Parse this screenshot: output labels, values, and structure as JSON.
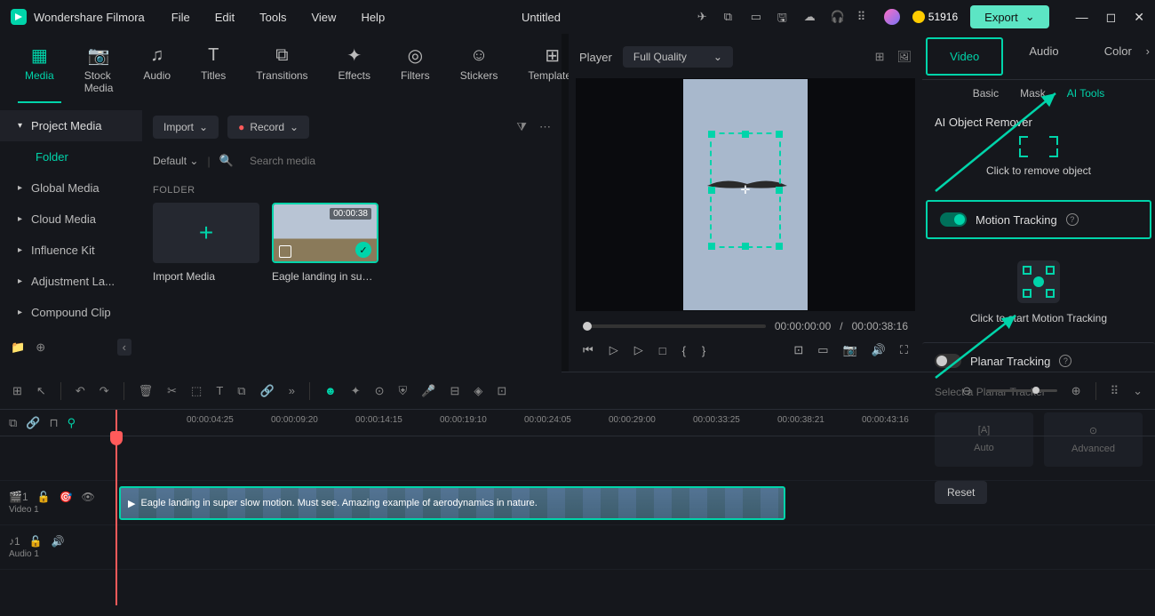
{
  "app": {
    "name": "Wondershare Filmora",
    "title": "Untitled"
  },
  "menu": [
    "File",
    "Edit",
    "Tools",
    "View",
    "Help"
  ],
  "credits": "51916",
  "export_label": "Export",
  "tool_tabs": [
    {
      "label": "Media",
      "active": true
    },
    {
      "label": "Stock Media"
    },
    {
      "label": "Audio"
    },
    {
      "label": "Titles"
    },
    {
      "label": "Transitions"
    },
    {
      "label": "Effects"
    },
    {
      "label": "Filters"
    },
    {
      "label": "Stickers"
    },
    {
      "label": "Templates"
    }
  ],
  "media_sidebar": {
    "header": "Project Media",
    "active": "Folder",
    "items": [
      "Global Media",
      "Cloud Media",
      "Influence Kit",
      "Adjustment La...",
      "Compound Clip"
    ]
  },
  "media_content": {
    "import_label": "Import",
    "record_label": "Record",
    "default_label": "Default",
    "search_placeholder": "Search media",
    "folder_label": "FOLDER",
    "import_media_label": "Import Media",
    "clip": {
      "duration": "00:00:38",
      "name": "Eagle landing in super..."
    }
  },
  "preview": {
    "player_label": "Player",
    "quality_label": "Full Quality",
    "current_time": "00:00:00:00",
    "total_time": "00:00:38:16"
  },
  "props": {
    "tabs": [
      "Video",
      "Audio",
      "Color"
    ],
    "subtabs": [
      "Basic",
      "Mask",
      "AI Tools"
    ],
    "remover_title": "AI Object Remover",
    "remover_action": "Click to remove object",
    "motion_title": "Motion Tracking",
    "motion_action": "Click to start Motion Tracking",
    "planar_title": "Planar Tracking",
    "planar_select": "Select a Planar Tracker",
    "planar_auto": "Auto",
    "planar_advanced": "Advanced",
    "reset": "Reset"
  },
  "timeline": {
    "ticks": [
      "00:00:04:25",
      "00:00:09:20",
      "00:00:14:15",
      "00:00:19:10",
      "00:00:24:05",
      "00:00:29:00",
      "00:00:33:25",
      "00:00:38:21",
      "00:00:43:16"
    ],
    "video_track": "Video 1",
    "audio_track": "Audio 1",
    "clip_text": "Eagle landing in super slow motion. Must see. Amazing example of aerodynamics in nature."
  }
}
